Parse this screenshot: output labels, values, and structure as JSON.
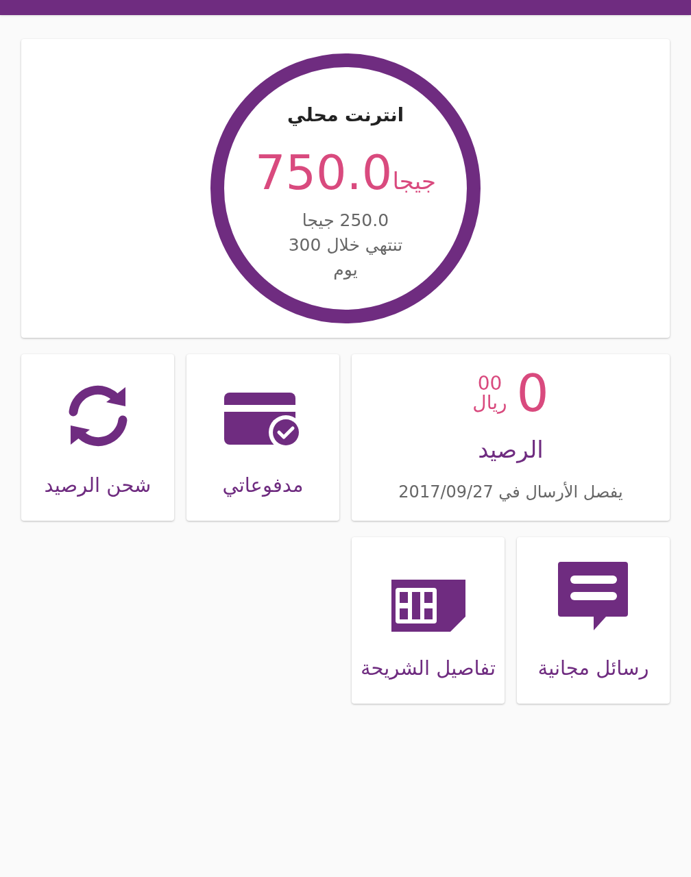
{
  "internet": {
    "title": "انترنت محلي",
    "amount": "750.0",
    "unit": "جيجا",
    "lines": [
      "250.0 جيجا",
      "تنتهي خلال 300",
      "يوم"
    ]
  },
  "balance": {
    "whole": "0",
    "fraction": "00",
    "currency": "ريال",
    "label": "الرصيد",
    "note": "يفصل الأرسال في 2017/09/27"
  },
  "tiles": [
    {
      "kind": "payments",
      "label": "مدفوعاتي"
    },
    {
      "kind": "recharge",
      "label": "شحن الرصيد"
    },
    {
      "kind": "messages",
      "label": "رسائل مجانية"
    },
    {
      "kind": "sim",
      "label": "تفاصيل الشريحة"
    }
  ]
}
